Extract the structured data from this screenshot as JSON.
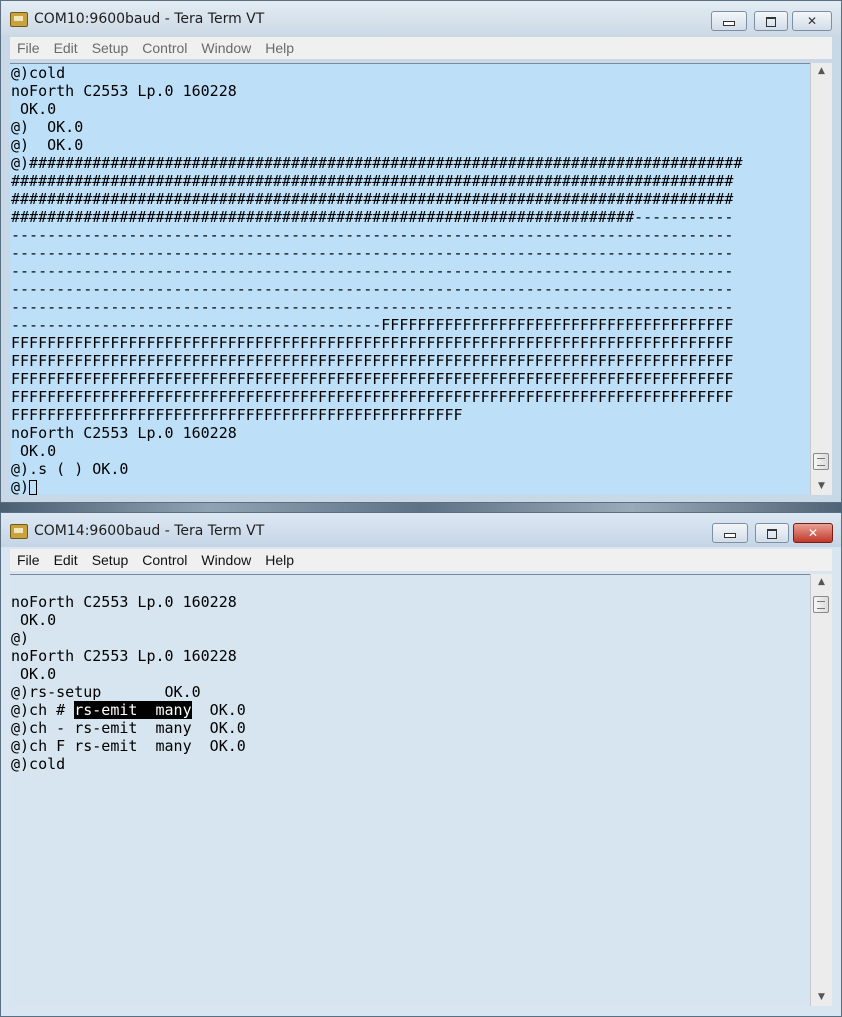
{
  "window1": {
    "title": "COM10:9600baud - Tera Term VT",
    "menu": [
      "File",
      "Edit",
      "Setup",
      "Control",
      "Window",
      "Help"
    ],
    "lines": [
      "@)cold",
      "noForth C2553 Lp.0 160228",
      " OK.0",
      "@)  OK.0",
      "@)  OK.0",
      "@)###############################################################################",
      "################################################################################",
      "################################################################################",
      "#####################################################################-----------",
      "--------------------------------------------------------------------------------",
      "--------------------------------------------------------------------------------",
      "--------------------------------------------------------------------------------",
      "--------------------------------------------------------------------------------",
      "--------------------------------------------------------------------------------",
      "-----------------------------------------FFFFFFFFFFFFFFFFFFFFFFFFFFFFFFFFFFFFFFF",
      "FFFFFFFFFFFFFFFFFFFFFFFFFFFFFFFFFFFFFFFFFFFFFFFFFFFFFFFFFFFFFFFFFFFFFFFFFFFFFFFF",
      "FFFFFFFFFFFFFFFFFFFFFFFFFFFFFFFFFFFFFFFFFFFFFFFFFFFFFFFFFFFFFFFFFFFFFFFFFFFFFFFF",
      "FFFFFFFFFFFFFFFFFFFFFFFFFFFFFFFFFFFFFFFFFFFFFFFFFFFFFFFFFFFFFFFFFFFFFFFFFFFFFFFF",
      "FFFFFFFFFFFFFFFFFFFFFFFFFFFFFFFFFFFFFFFFFFFFFFFFFFFFFFFFFFFFFFFFFFFFFFFFFFFFFFFF",
      "FFFFFFFFFFFFFFFFFFFFFFFFFFFFFFFFFFFFFFFFFFFFFFFFFF",
      "noForth C2553 Lp.0 160228",
      " OK.0",
      "@).s ( ) OK.0"
    ],
    "prompt": "@)"
  },
  "window2": {
    "title": "COM14:9600baud - Tera Term VT",
    "menu": [
      "File",
      "Edit",
      "Setup",
      "Control",
      "Window",
      "Help"
    ],
    "lines_before": [
      "",
      "noForth C2553 Lp.0 160228",
      " OK.0",
      "@)",
      "noForth C2553 Lp.0 160228",
      " OK.0",
      "@)rs-setup       OK.0"
    ],
    "highlight_line": {
      "prefix": "@)ch # ",
      "selected": "rs-emit  many",
      "suffix": "  OK.0"
    },
    "lines_after": [
      "@)ch - rs-emit  many  OK.0",
      "@)ch F rs-emit  many  OK.0",
      "@)cold"
    ]
  },
  "colors": {
    "terminal1_bg": "#bde0f8",
    "terminal2_bg": "#d6e5ef",
    "close_active": "#c0392b"
  }
}
